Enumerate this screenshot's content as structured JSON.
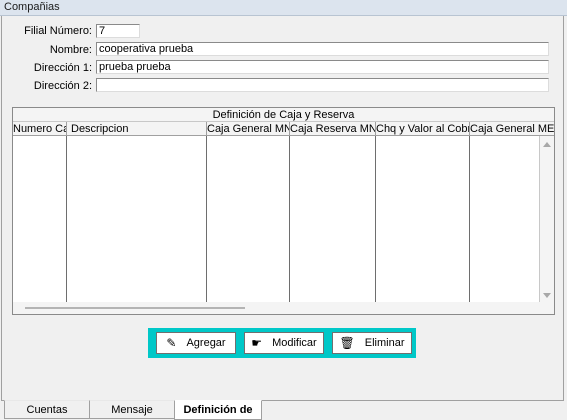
{
  "window": {
    "title": "Compañias"
  },
  "form": {
    "filial_label": "Filial Número:",
    "filial_value": "7",
    "nombre_label": "Nombre:",
    "nombre_value": "cooperativa prueba",
    "direccion1_label": "Dirección 1:",
    "direccion1_value": "prueba prueba",
    "direccion2_label": "Dirección 2:",
    "direccion2_value": ""
  },
  "grid": {
    "title": "Definición de Caja y Reserva",
    "columns": [
      "Numero Caja",
      "Descripcion",
      "Caja General MN",
      "Caja Reserva MN",
      "Chq y Valor al Cobro MN",
      "Caja General ME"
    ],
    "rows": []
  },
  "buttons": {
    "agregar": "Agregar",
    "modificar": "Modificar",
    "eliminar": "Eliminar"
  },
  "tabs": [
    "Cuentas",
    "Mensaje",
    "Definición de Cajas"
  ],
  "active_tab": "Definición de Cajas",
  "colors": {
    "button_panel": "#00c8c8",
    "window_bg": "#f0f0f0"
  }
}
